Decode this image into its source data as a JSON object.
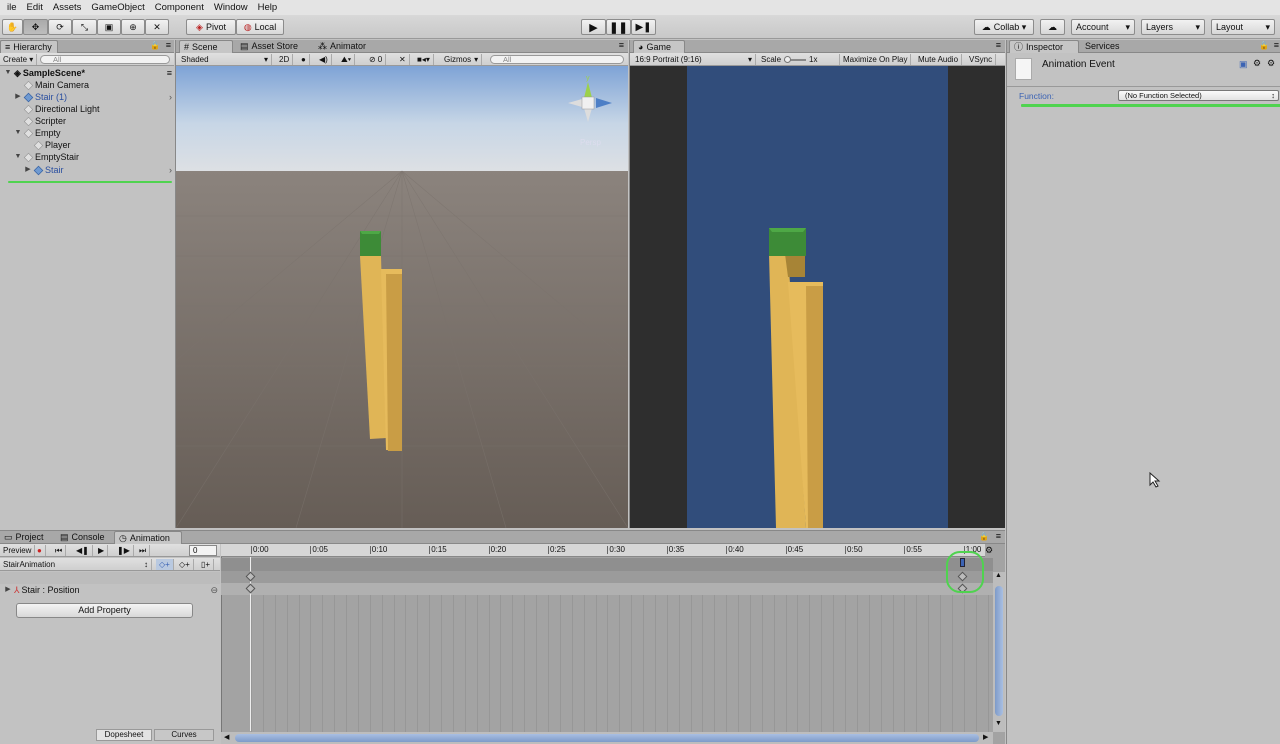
{
  "menu": [
    "ile",
    "Edit",
    "Assets",
    "GameObject",
    "Component",
    "Window",
    "Help"
  ],
  "toolbar": {
    "pivot": "Pivot",
    "local": "Local",
    "collab": "Collab ▾",
    "account": "Account",
    "layers": "Layers",
    "layout": "Layout"
  },
  "hierarchy": {
    "tab": "Hierarchy",
    "create": "Create",
    "search_placeholder": "All",
    "scene": "SampleScene*",
    "items": [
      "Main Camera",
      "Stair (1)",
      "Directional Light",
      "Scripter",
      "Empty",
      "Player",
      "EmptyStair",
      "Stair"
    ]
  },
  "scene": {
    "tabs": [
      "Scene",
      "Asset Store",
      "Animator"
    ],
    "shaded": "Shaded",
    "mode2d": "2D",
    "fx_count": "0",
    "gizmos": "Gizmos",
    "search_placeholder": "All",
    "persp": "Persp"
  },
  "game": {
    "tab": "Game",
    "aspect": "16:9 Portrait (9:16)",
    "scale_label": "Scale",
    "scale_value": "1x",
    "max_on_play": "Maximize On Play",
    "mute": "Mute Audio",
    "vsync": "VSync"
  },
  "inspector": {
    "tabs": [
      "Inspector",
      "Services"
    ],
    "title": "Animation Event",
    "function_label": "Function:",
    "function_value": "(No Function Selected)"
  },
  "bottom": {
    "tabs": [
      "Project",
      "Console",
      "Animation"
    ],
    "preview": "Preview",
    "frame": "0",
    "clip": "StairAnimation",
    "property": "Stair : Position",
    "add_property": "Add Property",
    "dopesheet": "Dopesheet",
    "curves": "Curves",
    "ticks": [
      "0:00",
      "0:05",
      "0:10",
      "0:15",
      "0:20",
      "0:25",
      "0:30",
      "0:35",
      "0:40",
      "0:45",
      "0:50",
      "0:55",
      "1:00"
    ]
  },
  "colors": {
    "accent_blue": "#3b63b4",
    "highlight_green": "#4fd34f",
    "sky": "#8aaed8",
    "ground": "#6e655e",
    "stair": "#e0b556",
    "stair_top": "#3d8b37",
    "game_bg": "#314d7b"
  }
}
